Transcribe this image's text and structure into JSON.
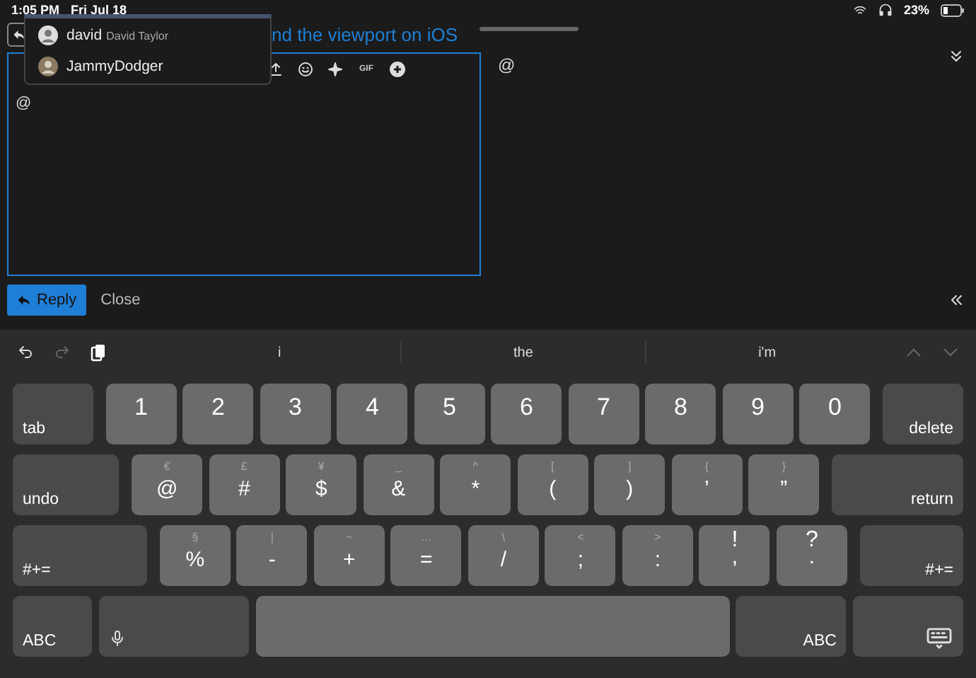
{
  "status_bar": {
    "time": "1:05 PM",
    "date": "Fri Jul 18",
    "battery": "23%"
  },
  "mention_menu": {
    "items": [
      {
        "username": "david",
        "full_name": "David Taylor"
      },
      {
        "username": "JammyDodger"
      }
    ]
  },
  "topic_title": "nd the viewport on iOS",
  "editor": {
    "toolbar": [
      {
        "kind": "upload"
      },
      {
        "kind": "emoji"
      },
      {
        "kind": "sparkle"
      },
      {
        "kind": "gif",
        "label": "GIF"
      },
      {
        "kind": "add"
      }
    ],
    "value": "@",
    "side_text": "@"
  },
  "actions": {
    "reply": "Reply",
    "close": "Close"
  },
  "keyboard": {
    "suggestions": [
      "i",
      "the",
      "i'm"
    ],
    "rows": [
      [
        {
          "kind": "fn",
          "label": "tab"
        },
        {
          "kind": "char",
          "label": "1"
        },
        {
          "kind": "char",
          "label": "2"
        },
        {
          "kind": "char",
          "label": "3"
        },
        {
          "kind": "char",
          "label": "4"
        },
        {
          "kind": "char",
          "label": "5"
        },
        {
          "kind": "char",
          "label": "6"
        },
        {
          "kind": "char",
          "label": "7"
        },
        {
          "kind": "char",
          "label": "8"
        },
        {
          "kind": "char",
          "label": "9"
        },
        {
          "kind": "char",
          "label": "0"
        },
        {
          "kind": "fn",
          "label": "delete"
        }
      ],
      [
        {
          "kind": "fn",
          "label": "undo"
        },
        {
          "kind": "char",
          "alt": "€",
          "label": "@"
        },
        {
          "kind": "char",
          "alt": "£",
          "label": "#"
        },
        {
          "kind": "char",
          "alt": "¥",
          "label": "$"
        },
        {
          "kind": "char",
          "alt": "_",
          "label": "&"
        },
        {
          "kind": "char",
          "alt": "^",
          "label": "*"
        },
        {
          "kind": "char",
          "alt": "[",
          "label": "("
        },
        {
          "kind": "char",
          "alt": "]",
          "label": ")"
        },
        {
          "kind": "char",
          "alt": "{",
          "label": "’"
        },
        {
          "kind": "char",
          "alt": "}",
          "label": "”"
        },
        {
          "kind": "fn",
          "label": "return"
        }
      ],
      [
        {
          "kind": "fn",
          "label": "#+="
        },
        {
          "kind": "char",
          "alt": "§",
          "label": "%"
        },
        {
          "kind": "char",
          "alt": "|",
          "label": "-"
        },
        {
          "kind": "char",
          "alt": "~",
          "label": "+"
        },
        {
          "kind": "char",
          "alt": "…",
          "label": "="
        },
        {
          "kind": "char",
          "alt": "\\",
          "label": "/"
        },
        {
          "kind": "char",
          "alt": "<",
          "label": ";"
        },
        {
          "kind": "char",
          "alt": ">",
          "label": ":"
        },
        {
          "kind": "dual",
          "alt": "!",
          "label": ","
        },
        {
          "kind": "dual",
          "alt": "?",
          "label": "."
        },
        {
          "kind": "fn",
          "label": "#+="
        }
      ],
      [
        {
          "kind": "fn",
          "label": "ABC"
        },
        {
          "kind": "mic"
        },
        {
          "kind": "space"
        },
        {
          "kind": "fn",
          "label": "ABC"
        },
        {
          "kind": "hide"
        }
      ]
    ]
  }
}
